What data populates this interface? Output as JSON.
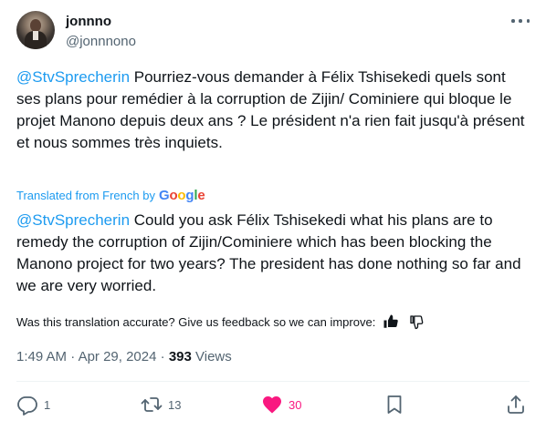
{
  "author": {
    "name": "jonnno",
    "handle": "@jonnnono"
  },
  "original": {
    "mention": "@StvSprecherin",
    "text": " Pourriez-vous demander à Félix Tshisekedi quels sont ses plans pour remédier à la corruption de Zijin/ Cominiere qui bloque le projet Manono depuis deux ans ? Le président n'a rien fait jusqu'à présent et nous sommes très inquiets."
  },
  "translation_notice": {
    "label": "Translated from French by",
    "brand_parts": [
      "G",
      "o",
      "o",
      "g",
      "l",
      "e"
    ]
  },
  "translation": {
    "mention": "@StvSprecherin",
    "text": " Could you ask Félix Tshisekedi what his plans are to remedy the corruption of Zijin/Cominiere which has been blocking the Manono project for two years? The president has done nothing so far and we are very worried."
  },
  "feedback": {
    "question": "Was this translation accurate? Give us feedback so we can improve:",
    "icons": [
      "thumbs-up-icon",
      "thumbs-down-icon"
    ]
  },
  "meta": {
    "time": "1:49 AM",
    "separator": "·",
    "date": "Apr 29, 2024",
    "views_count": "393",
    "views_label": "Views"
  },
  "actions": {
    "replies": "1",
    "reposts": "13",
    "likes": "30"
  },
  "colors": {
    "accent": "#1d9bf0",
    "like": "#f91880",
    "muted": "#536471"
  }
}
